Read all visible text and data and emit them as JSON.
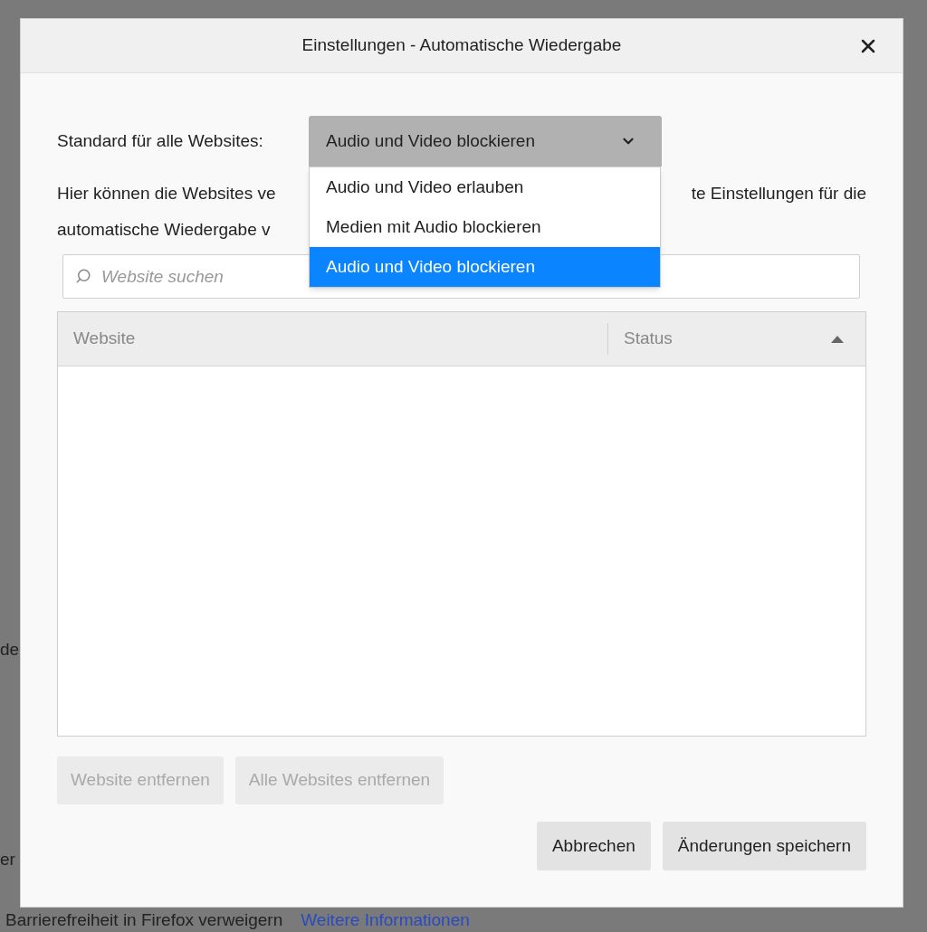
{
  "background": {
    "fragments": [
      "de",
      "er"
    ],
    "footer_text": "Barrierefreiheit in Firefox verweigern",
    "footer_link": "Weitere Informationen"
  },
  "dialog": {
    "title": "Einstellungen - Automatische Wiedergabe",
    "default_label": "Standard für alle Websites:",
    "select": {
      "value": "Audio und Video blockieren",
      "expanded": true,
      "options": [
        {
          "label": "Audio und Video erlauben",
          "selected": false
        },
        {
          "label": "Medien mit Audio blockieren",
          "selected": false
        },
        {
          "label": "Audio und Video blockieren",
          "selected": true
        }
      ]
    },
    "description": {
      "line_1_start": "Hier können die Websites ve",
      "line_1_end": "te Einstellungen für die",
      "line_2_start": "automatische Wiedergabe v"
    },
    "search": {
      "placeholder": "Website suchen"
    },
    "table": {
      "columns": [
        {
          "label": "Website"
        },
        {
          "label": "Status",
          "sorted_ascending": true
        }
      ]
    },
    "actions": [
      {
        "label": "Website entfernen",
        "disabled": true
      },
      {
        "label": "Alle Websites entfernen",
        "disabled": true
      }
    ],
    "buttons": [
      {
        "label": "Abbrechen"
      },
      {
        "label": "Änderungen speichern"
      }
    ]
  }
}
